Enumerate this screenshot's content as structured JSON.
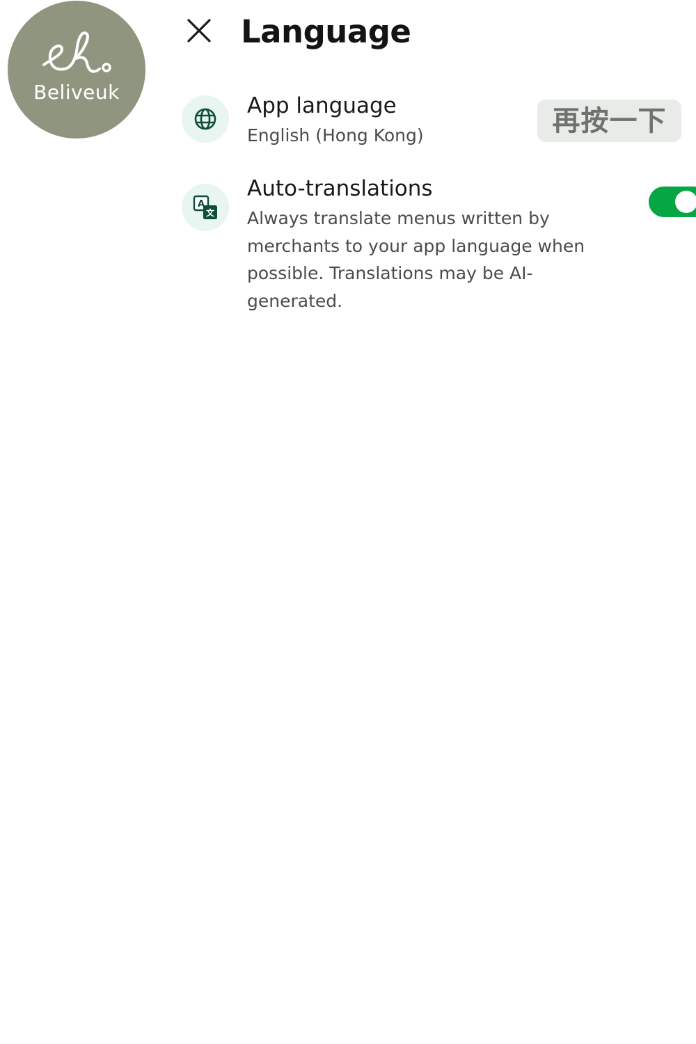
{
  "logo": {
    "text": "Beliveuk",
    "mark": "ek",
    "color": "#90957f"
  },
  "header": {
    "close_icon": "close-icon",
    "title": "Language"
  },
  "settings": {
    "app_language": {
      "icon": "globe-icon",
      "title": "App language",
      "value": "English (Hong Kong)"
    },
    "auto_translations": {
      "icon": "translate-icon",
      "title": "Auto-translations",
      "description_lines": [
        "Always translate menus written by",
        "merchants to your app language when",
        "possible. Translations may be AI-",
        "generated."
      ],
      "enabled": true
    }
  },
  "overlay": {
    "retap_label": "再按一下"
  },
  "colors": {
    "accent_green": "#07a645",
    "icon_green": "#0d4f36",
    "icon_bg": "#e8f5f1",
    "title_text": "#141414",
    "body_text": "#4b4b4b"
  }
}
